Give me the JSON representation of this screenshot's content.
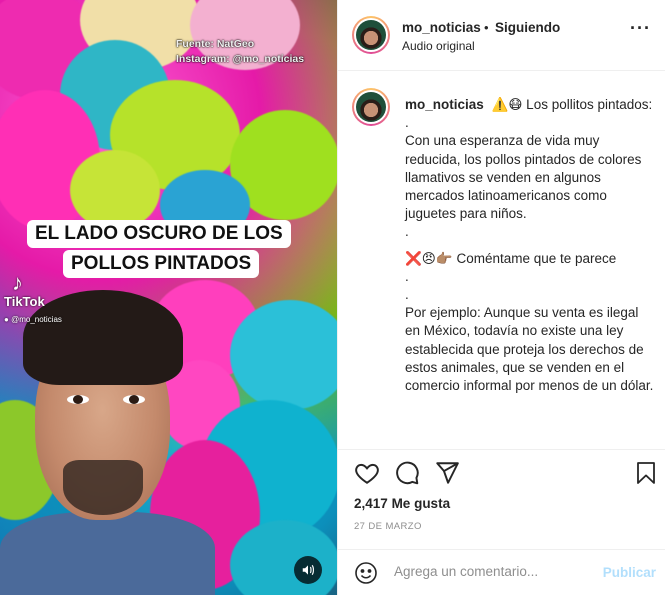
{
  "media": {
    "source_line": "Fuente: NatGeo",
    "instagram_line": "Instagram: @mo_noticias",
    "headline_1": "EL LADO OSCURO DE LOS",
    "headline_2": "POLLOS PINTADOS",
    "tiktok_label": "TikTok",
    "tiktok_handle": "@mo_noticias",
    "sound_icon": "speaker-icon"
  },
  "header": {
    "username": "mo_noticias",
    "separator": "•",
    "follow_label": "Siguiendo",
    "audio_label": "Audio original",
    "more_icon": "more-icon"
  },
  "caption": {
    "username": "mo_noticias",
    "lines": [
      "⚠️😷 Los pollitos pintados:",
      ".",
      "Con una esperanza de vida muy reducida, los pollos pintados de colores llamativos se venden en algunos mercados latinoamericanos como juguetes para niños.",
      ".",
      "❌😠👉🏽 Coméntame que te parece",
      ".",
      ".",
      "Por ejemplo: Aunque su venta es ilegal en México, todavía no existe una ley establecida que proteja los derechos de estos animales, que se venden en el comercio informal por menos de un dólar."
    ]
  },
  "actions": {
    "likes_count": "2,417",
    "likes_label": "Me gusta",
    "date": "27 DE MARZO"
  },
  "comment": {
    "placeholder": "Agrega un comentario...",
    "publish_label": "Publicar"
  },
  "colors": {
    "publish_disabled": "#b2dffc",
    "border": "#efefef",
    "muted": "#8e8e8e"
  }
}
